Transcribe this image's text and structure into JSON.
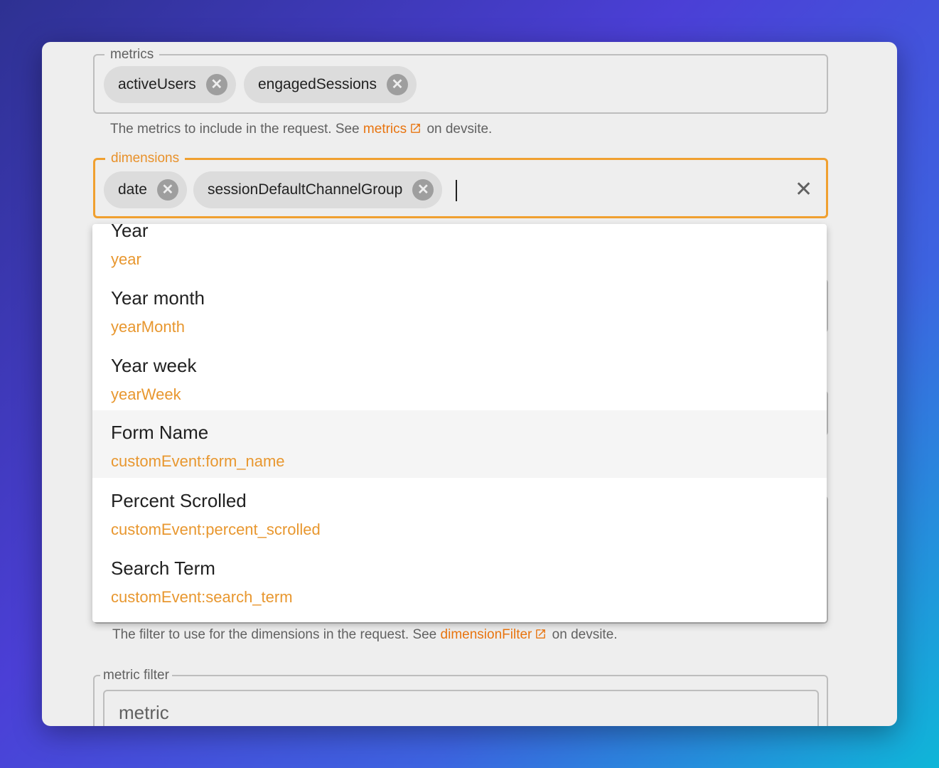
{
  "metrics": {
    "legend": "metrics",
    "chips": [
      "activeUsers",
      "engagedSessions"
    ],
    "helper": {
      "prefix": "The metrics to include in the request. See",
      "link": "metrics",
      "suffix": "on devsite."
    }
  },
  "dimensions": {
    "legend": "dimensions",
    "chips": [
      "date",
      "sessionDefaultChannelGroup"
    ],
    "options": [
      {
        "label": "Year",
        "id": "year"
      },
      {
        "label": "Year month",
        "id": "yearMonth"
      },
      {
        "label": "Year week",
        "id": "yearWeek"
      },
      {
        "label": "Form Name",
        "id": "customEvent:form_name"
      },
      {
        "label": "Percent Scrolled",
        "id": "customEvent:percent_scrolled"
      },
      {
        "label": "Search Term",
        "id": "customEvent:search_term"
      }
    ]
  },
  "dimension_filter": {
    "helper": {
      "prefix": "The filter to use for the dimensions in the request. See",
      "link": "dimensionFilter",
      "suffix": "on devsite."
    }
  },
  "metric_filter": {
    "legend": "metric filter",
    "placeholder": "metric"
  },
  "colors": {
    "accent": "#f0a030",
    "link": "#e8740f",
    "option_id": "#e8972f"
  }
}
